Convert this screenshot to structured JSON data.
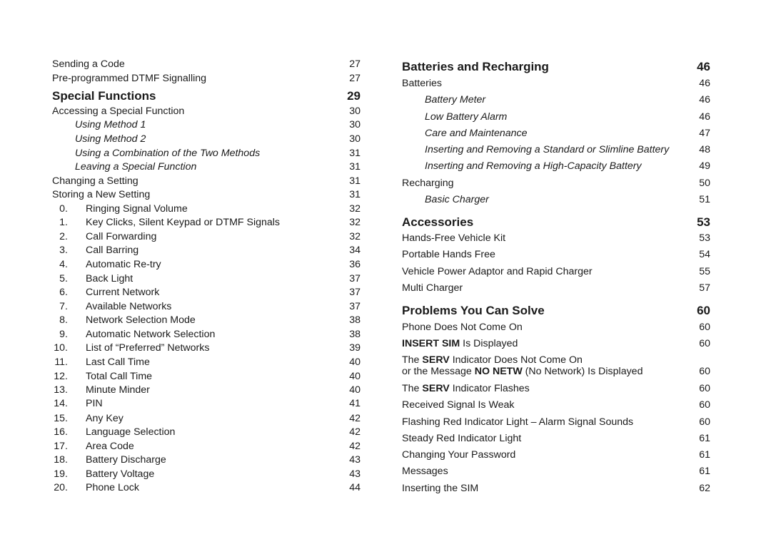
{
  "left_column": [
    {
      "type": "entry",
      "title": "Sending a Code",
      "page": "27"
    },
    {
      "type": "entry",
      "title": "Pre-programmed DTMF Signalling",
      "page": "27"
    },
    {
      "type": "heading",
      "title": "Special Functions",
      "page": "29"
    },
    {
      "type": "entry",
      "title": "Accessing a Special Function",
      "page": "30"
    },
    {
      "type": "sub",
      "title": "Using Method 1",
      "page": "30"
    },
    {
      "type": "sub",
      "title": "Using Method 2",
      "page": "30"
    },
    {
      "type": "sub",
      "title": "Using a Combination of the Two Methods",
      "page": "31"
    },
    {
      "type": "sub",
      "title": "Leaving a Special Function",
      "page": "31"
    },
    {
      "type": "entry",
      "title": "Changing a Setting",
      "page": "31"
    },
    {
      "type": "entry",
      "title": "Storing a New Setting",
      "page": "31"
    },
    {
      "type": "numbered",
      "num": "0.",
      "title": "Ringing Signal Volume",
      "page": "32"
    },
    {
      "type": "numbered",
      "num": "1.",
      "title": "Key Clicks, Silent Keypad or DTMF Signals",
      "page": "32"
    },
    {
      "type": "numbered",
      "num": "2.",
      "title": "Call Forwarding",
      "page": "32"
    },
    {
      "type": "numbered",
      "num": "3.",
      "title": "Call Barring",
      "page": "34"
    },
    {
      "type": "numbered",
      "num": "4.",
      "title": "Automatic Re-try",
      "page": "36"
    },
    {
      "type": "numbered",
      "num": "5.",
      "title": "Back Light",
      "page": "37"
    },
    {
      "type": "numbered",
      "num": "6.",
      "title": "Current Network",
      "page": "37"
    },
    {
      "type": "numbered",
      "num": "7.",
      "title": "Available Networks",
      "page": "37"
    },
    {
      "type": "numbered",
      "num": "8.",
      "title": "Network Selection Mode",
      "page": "38"
    },
    {
      "type": "numbered",
      "num": "9.",
      "title": "Automatic Network Selection",
      "page": "38"
    },
    {
      "type": "numbered",
      "num": "10.",
      "title": "List of “Preferred” Networks",
      "page": "39"
    },
    {
      "type": "numbered",
      "num": "11.",
      "title": "Last Call Time",
      "page": "40"
    },
    {
      "type": "numbered",
      "num": "12.",
      "title": "Total Call Time",
      "page": "40"
    },
    {
      "type": "numbered",
      "num": "13.",
      "title": "Minute Minder",
      "page": "40"
    },
    {
      "type": "numbered",
      "num": "14.",
      "title": "PIN",
      "page": "41"
    },
    {
      "type": "numbered",
      "num": "15.",
      "title": "Any Key",
      "page": "42"
    },
    {
      "type": "numbered",
      "num": "16.",
      "title": "Language Selection",
      "page": "42"
    },
    {
      "type": "numbered",
      "num": "17.",
      "title": "Area Code",
      "page": "42"
    },
    {
      "type": "numbered",
      "num": "18.",
      "title": "Battery Discharge",
      "page": "43"
    },
    {
      "type": "numbered",
      "num": "19.",
      "title": "Battery Voltage",
      "page": "43"
    },
    {
      "type": "numbered",
      "num": "20.",
      "title": "Phone Lock",
      "page": "44"
    }
  ],
  "right_column": [
    {
      "type": "heading",
      "title": "Batteries and Recharging",
      "page": "46"
    },
    {
      "type": "entry",
      "title": "Batteries",
      "page": "46"
    },
    {
      "type": "sub",
      "title": "Battery Meter",
      "page": "46"
    },
    {
      "type": "sub",
      "title": "Low Battery Alarm",
      "page": "46"
    },
    {
      "type": "sub",
      "title": "Care and Maintenance",
      "page": "47"
    },
    {
      "type": "sub",
      "title": "Inserting and Removing a Standard or Slimline Battery",
      "page": "48"
    },
    {
      "type": "sub",
      "title": "Inserting and Removing a High-Capacity Battery",
      "page": "49"
    },
    {
      "type": "entry",
      "title": "Recharging",
      "page": "50"
    },
    {
      "type": "sub",
      "title": "Basic Charger",
      "page": "51"
    },
    {
      "type": "heading",
      "title": "Accessories",
      "page": "53"
    },
    {
      "type": "entry",
      "title": "Hands-Free Vehicle Kit",
      "page": "53"
    },
    {
      "type": "entry",
      "title": "Portable Hands Free",
      "page": "54"
    },
    {
      "type": "entry",
      "title": "Vehicle Power Adaptor and Rapid Charger",
      "page": "55"
    },
    {
      "type": "entry",
      "title": "Multi Charger",
      "page": "57"
    },
    {
      "type": "heading",
      "title": "Problems You Can Solve",
      "page": "60"
    },
    {
      "type": "entry",
      "title": "Phone Does Not Come On",
      "page": "60"
    },
    {
      "type": "entry",
      "bold": "INSERT SIM",
      "title": " Is Displayed",
      "page": "60"
    },
    {
      "type": "two",
      "pre": "The ",
      "bold": "SERV",
      "title": " Indicator Does Not Come On",
      "pre2": "or the Message ",
      "bold2": "NO NETW",
      "title2": " (No Network) Is Displayed",
      "page": "60"
    },
    {
      "type": "entry",
      "pre": "The ",
      "bold": "SERV",
      "title": " Indicator Flashes",
      "page": "60"
    },
    {
      "type": "entry",
      "title": "Received Signal Is Weak",
      "page": "60"
    },
    {
      "type": "entry",
      "title": "Flashing Red Indicator Light  –  Alarm Signal Sounds",
      "page": "60"
    },
    {
      "type": "entry",
      "title": "Steady Red Indicator Light",
      "page": "61"
    },
    {
      "type": "entry",
      "title": "Changing Your Password",
      "page": "61"
    },
    {
      "type": "entry",
      "title": "Messages",
      "page": "61"
    },
    {
      "type": "entry",
      "title": "Inserting the SIM",
      "page": "62"
    }
  ]
}
